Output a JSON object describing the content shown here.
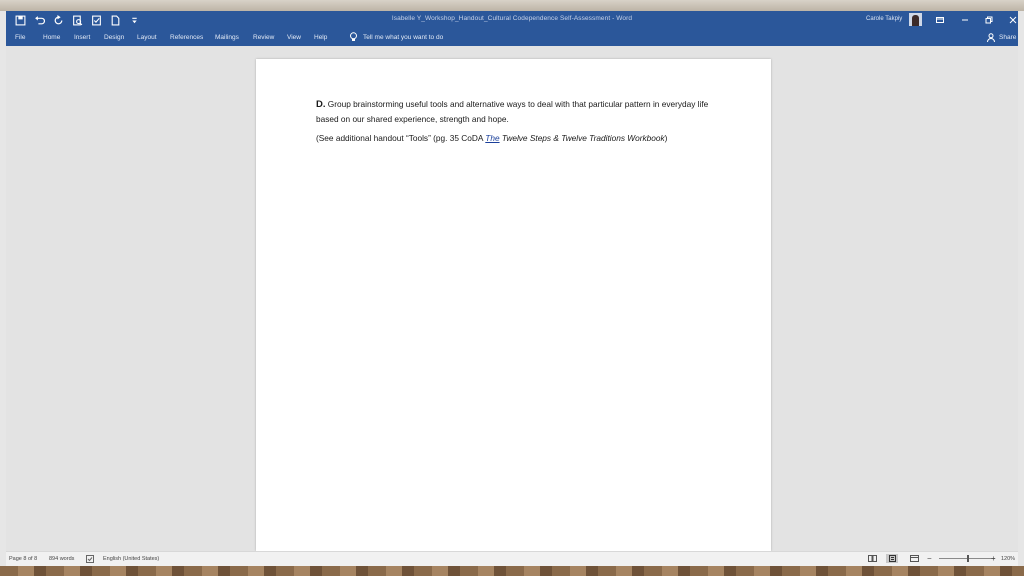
{
  "window": {
    "title": "Isabelle Y_Workshop_Handout_Cultural Codependence Self-Assessment  -  Word",
    "user": "Carole Takpiy"
  },
  "quick_access": [
    "save-icon",
    "undo-icon",
    "redo-icon",
    "print-preview-icon",
    "spelling-icon",
    "new-doc-icon",
    "customize-icon"
  ],
  "ribbon": {
    "tabs": [
      "File",
      "Home",
      "Insert",
      "Design",
      "Layout",
      "References",
      "Mailings",
      "Review",
      "View",
      "Help"
    ],
    "tell_me": "Tell me what you want to do",
    "share": "Share"
  },
  "document": {
    "para1_lead": "D.",
    "para1_text": " Group brainstorming useful tools and alternative ways to deal with that particular pattern in everyday life based on our shared experience, strength and hope.",
    "para2_start": "(See additional handout “Tools” (pg. 35 CoDA ",
    "para2_link": "The",
    "para2_italic": " Twelve Steps & Twelve Traditions Workbook",
    "para2_end": ")"
  },
  "status": {
    "page": "Page 8 of 8",
    "words": "894 words",
    "language": "English (United States)",
    "zoom": "120%",
    "zoom_minus": "−",
    "zoom_plus": "+"
  },
  "colors": {
    "ribbon": "#2b579a",
    "page": "#ffffff",
    "canvas": "#e3e3e3"
  }
}
